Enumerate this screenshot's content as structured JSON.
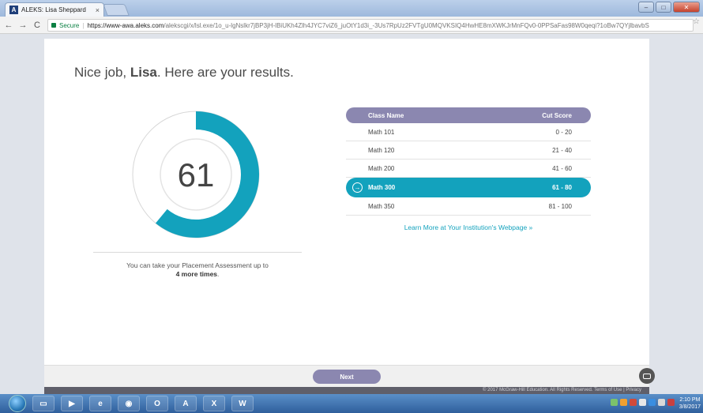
{
  "browser": {
    "tab_title": "ALEKS: Lisa Sheppard",
    "tab_close": "×",
    "favicon_letter": "A",
    "secure_label": "Secure",
    "url_host": "https://www-awa.aleks.com",
    "url_path": "/alekscgi/x/lsl.exe/1o_u-lgNslkr7jBP3jH-lBiUKh4Zlh4JYC7viZ6_juOtY1d3i_-3Us7RpUz2FVTgU0MQVKSIQ4HwHE8mXWKJrMnFQv0-0PPSaFas98W0qeqi?1oBw7QYjlbavbS"
  },
  "results": {
    "heading_prefix": "Nice job, ",
    "user_name": "Lisa",
    "heading_suffix": ". Here are your results.",
    "score": "61",
    "score_value": 61,
    "score_max": 100,
    "retake_line1": "You can take your Placement Assessment up to",
    "retake_line2": "4 more times",
    "retake_period": "."
  },
  "table": {
    "col_class": "Class Name",
    "col_cut": "Cut Score",
    "rows": [
      {
        "name": "Math 101",
        "cut": "0 - 20"
      },
      {
        "name": "Math 120",
        "cut": "21 - 40"
      },
      {
        "name": "Math 200",
        "cut": "41 - 60"
      },
      {
        "name": "Math 300",
        "cut": "61 - 80"
      },
      {
        "name": "Math 350",
        "cut": "81 - 100"
      }
    ],
    "learn_more": "Learn More at Your Institution's Webpage »"
  },
  "footer": {
    "next_label": "Next",
    "copyright": "© 2017 McGraw-Hill Education. All Rights Reserved.   Terms of Use  |  Privacy"
  },
  "taskbar": {
    "clock_time": "2:10 PM",
    "clock_date": "3/8/2017"
  },
  "colors": {
    "accent": "#13a2bd",
    "header_purple": "#8b87b0"
  }
}
